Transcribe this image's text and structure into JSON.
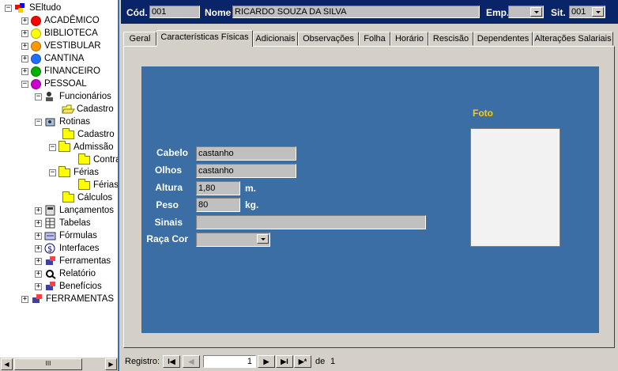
{
  "tree": {
    "root": "SEltudo",
    "items": [
      {
        "label": "ACADÊMICO",
        "color": "#ff0000"
      },
      {
        "label": "BIBLIOTECA",
        "color": "#ffff00"
      },
      {
        "label": "VESTIBULAR",
        "color": "#ff9900"
      },
      {
        "label": "CANTINA",
        "color": "#1e6fff"
      },
      {
        "label": "FINANCEIRO",
        "color": "#00b000"
      },
      {
        "label": "PESSOAL",
        "color": "#cc00cc"
      }
    ],
    "pessoal": {
      "funcionarios": "Funcionários",
      "cadastro": "Cadastro",
      "rotinas": "Rotinas",
      "rot_cadastro": "Cadastro",
      "admissao": "Admissão",
      "contrat": "Contrat",
      "ferias": "Férias",
      "ferias_sub": "Férias",
      "calculos": "Cálculos",
      "lancamentos": "Lançamentos",
      "tabelas": "Tabelas",
      "formulas": "Fórmulas",
      "interfaces": "Interfaces",
      "ferramentas": "Ferramentas",
      "relatorio": "Relatório",
      "beneficios": "Benefícios"
    },
    "ferramentas_root": "FERRAMENTAS",
    "scroll_thumb": "III"
  },
  "header": {
    "cod_label": "Cód.",
    "cod_value": "001",
    "nome_label": "Nome",
    "nome_value": "RICARDO SOUZA DA SILVA",
    "emp_label": "Emp.",
    "emp_value": "",
    "sit_label": "Sit.",
    "sit_value": "001"
  },
  "tabs": [
    "Geral",
    "Características Físicas",
    "Adicionais",
    "Observações",
    "Folha",
    "Horário",
    "Rescisão",
    "Dependentes",
    "Alterações Salariais"
  ],
  "form": {
    "cabelo_label": "Cabelo",
    "cabelo_value": "castanho",
    "olhos_label": "Olhos",
    "olhos_value": "castanho",
    "altura_label": "Altura",
    "altura_value": "1,80",
    "altura_unit": "m.",
    "peso_label": "Peso",
    "peso_value": "80",
    "peso_unit": "kg.",
    "sinais_label": "Sinais",
    "sinais_value": "",
    "raca_label": "Raça Cor",
    "raca_value": "",
    "foto_label": "Foto"
  },
  "nav": {
    "label": "Registro:",
    "current": "1",
    "of_label": "de",
    "total": "1",
    "first": "I◀",
    "prev": "◀",
    "next": "▶",
    "last": "▶I",
    "new": "▶*"
  },
  "colors": {
    "header_bg": "#0a246a",
    "panel_blue": "#3a6ea5",
    "foto_label": "#ffcc00"
  }
}
